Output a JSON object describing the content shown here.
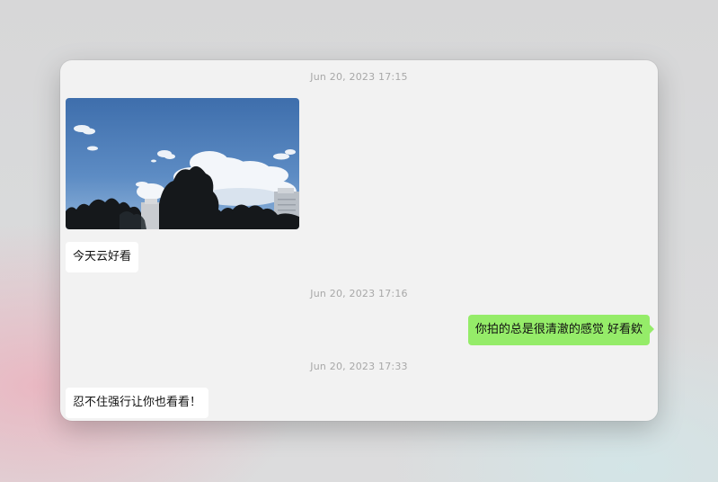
{
  "chat": {
    "timestamps": [
      "Jun 20, 2023 17:15",
      "Jun 20, 2023 17:16",
      "Jun 20, 2023 17:33"
    ],
    "messages": [
      {
        "type": "image",
        "direction": "incoming",
        "content": "photo of blue sky with white clouds above trees and buildings"
      },
      {
        "type": "text",
        "direction": "incoming",
        "text": "今天云好看"
      },
      {
        "type": "text",
        "direction": "outgoing",
        "text": "你拍的总是很清澈的感觉 好看欸"
      },
      {
        "type": "text",
        "direction": "incoming",
        "text": "忍不住强行让你也看看！"
      }
    ]
  },
  "colors": {
    "outgoing_bubble": "#95ec69",
    "incoming_bubble": "#ffffff",
    "window_bg": "#f2f2f2",
    "timestamp_text": "#a8a8a8"
  }
}
